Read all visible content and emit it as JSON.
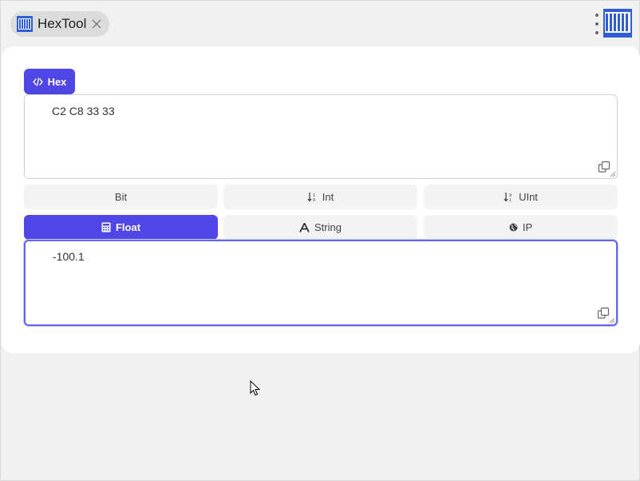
{
  "app": {
    "tab_title": "HexTool",
    "logo_text": "HEXTOOL"
  },
  "hex_panel": {
    "badge_label": "Hex",
    "value": "C2 C8 33 33"
  },
  "type_buttons": [
    {
      "label": "Bit",
      "icon": "none",
      "selected": false
    },
    {
      "label": "Int",
      "icon": "sort-numeric-down-icon",
      "selected": false
    },
    {
      "label": "UInt",
      "icon": "sort-numeric-up-icon",
      "selected": false
    },
    {
      "label": "Float",
      "icon": "calculator-icon",
      "selected": true
    },
    {
      "label": "String",
      "icon": "font-icon",
      "selected": false
    },
    {
      "label": "IP",
      "icon": "globe-icon",
      "selected": false
    }
  ],
  "output_panel": {
    "value": "-100.1"
  },
  "colors": {
    "accent": "#4f46e5",
    "background": "#f1f1f1",
    "button_bg": "#f2f3f5"
  }
}
